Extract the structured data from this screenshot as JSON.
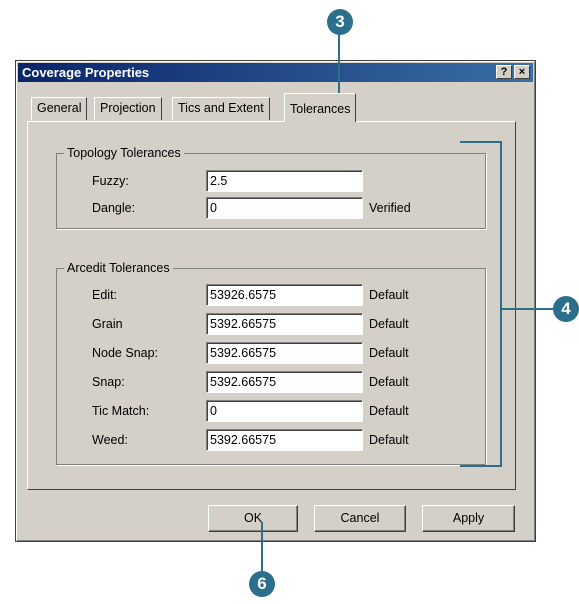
{
  "window": {
    "title": "Coverage Properties",
    "help_label": "?",
    "close_label": "×"
  },
  "tabs": [
    {
      "label": "General"
    },
    {
      "label": "Projection"
    },
    {
      "label": "Tics and Extent"
    },
    {
      "label": "Tolerances",
      "active": true
    }
  ],
  "topology": {
    "title": "Topology Tolerances",
    "fuzzy": {
      "label": "Fuzzy:",
      "value": "2.5"
    },
    "dangle": {
      "label": "Dangle:",
      "value": "0",
      "status": "Verified"
    }
  },
  "arcedit": {
    "title": "Arcedit Tolerances",
    "rows": [
      {
        "label": "Edit:",
        "value": "53926.6575",
        "status": "Default"
      },
      {
        "label": "Grain",
        "value": "5392.66575",
        "status": "Default"
      },
      {
        "label": "Node Snap:",
        "value": "5392.66575",
        "status": "Default"
      },
      {
        "label": "Snap:",
        "value": "5392.66575",
        "status": "Default"
      },
      {
        "label": "Tic Match:",
        "value": "0",
        "status": "Default"
      },
      {
        "label": "Weed:",
        "value": "5392.66575",
        "status": "Default"
      }
    ]
  },
  "buttons": {
    "ok": "OK",
    "cancel": "Cancel",
    "apply": "Apply"
  },
  "callouts": {
    "tab": "3",
    "bracket": "4",
    "ok": "6"
  },
  "colors": {
    "title_bar": "#0a246a",
    "callout": "#2b6f8c",
    "dialog": "#d4d0c8"
  }
}
